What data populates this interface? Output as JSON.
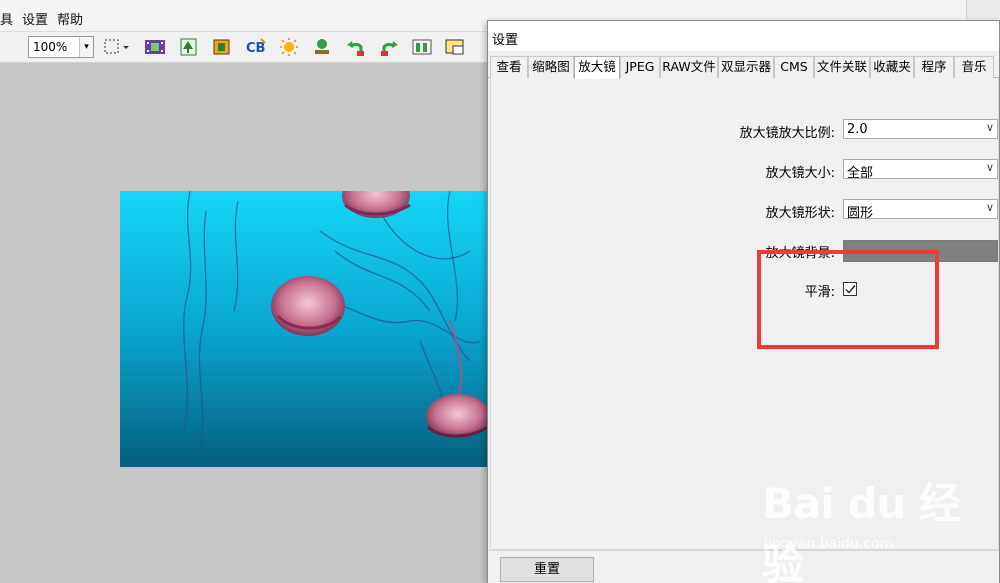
{
  "menubar": {
    "items": [
      "具",
      "设置",
      "帮助"
    ]
  },
  "toolbar": {
    "zoom_value": "100%",
    "icons": [
      "selection-icon",
      "filmstrip-icon",
      "image-tree-icon",
      "image-crop-icon",
      "cb-icon",
      "sun-icon",
      "stamp-icon",
      "rotate-left-icon",
      "rotate-right-icon",
      "compare-icon",
      "window-icon"
    ]
  },
  "dialog": {
    "title": "设置",
    "tabs": [
      {
        "label": "查看",
        "active": false
      },
      {
        "label": "缩略图",
        "active": false
      },
      {
        "label": "放大镜",
        "active": true
      },
      {
        "label": "JPEG",
        "active": false
      },
      {
        "label": "RAW文件",
        "active": false
      },
      {
        "label": "双显示器",
        "active": false
      },
      {
        "label": "CMS",
        "active": false
      },
      {
        "label": "文件关联",
        "active": false
      },
      {
        "label": "收藏夹",
        "active": false
      },
      {
        "label": "程序",
        "active": false
      },
      {
        "label": "音乐",
        "active": false
      }
    ],
    "form": {
      "ratio_label": "放大镜放大比例:",
      "ratio_value": "2.0",
      "size_label": "放大镜大小:",
      "size_value": "全部",
      "shape_label": "放大镜形状:",
      "shape_value": "圆形",
      "bg_label": "放大镜背景:",
      "bg_color": "#808080",
      "smooth_label": "平滑:",
      "smooth_checked": true
    },
    "reset_label": "重置"
  },
  "colors": {
    "highlight": "#ee3a3a",
    "photo_top": "#11d4f5",
    "photo_bottom": "#04657f"
  },
  "watermark": {
    "logo": "Bai du 经验",
    "url": "jingyan.baidu.com"
  }
}
